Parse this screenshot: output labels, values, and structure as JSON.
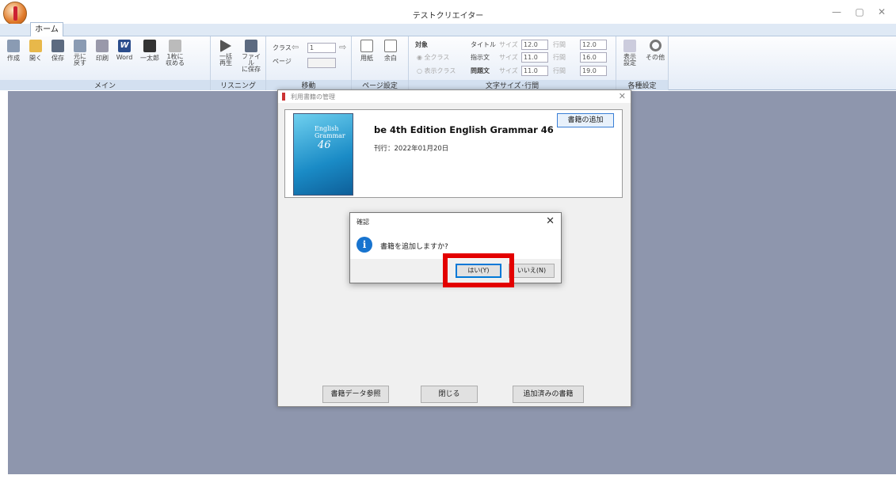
{
  "window": {
    "title": "テストクリエイター",
    "minimize": "—",
    "maximize": "▢",
    "close": "✕"
  },
  "tabs": {
    "home": "ホーム"
  },
  "ribbon": {
    "main": {
      "label": "メイン",
      "create": "作成",
      "open": "開く",
      "save": "保存",
      "undo": "元に\n戻す",
      "print": "印刷",
      "word": "Word",
      "ichitaro": "一太郎",
      "fit": "1枚に\n収める"
    },
    "listening": {
      "label": "リスニング",
      "play_all": "一括\n再生",
      "save_file": "ファイル\nに保存"
    },
    "move": {
      "label": "移動",
      "class": "クラス",
      "page": "ページ",
      "class_value": "1"
    },
    "page_setup": {
      "label": "ページ設定",
      "paper": "用紙",
      "margin": "余白"
    },
    "font": {
      "label": "文字サイズ･行間",
      "target": "対象",
      "all_class": "全クラス",
      "display_class": "表示クラス",
      "title": "タイトル",
      "instruction": "指示文",
      "question": "問題文",
      "size": "サイズ",
      "line": "行間",
      "title_size": "12.0",
      "instruction_size": "11.0",
      "question_size": "11.0",
      "title_line": "12.0",
      "instruction_line": "16.0",
      "question_line": "19.0"
    },
    "settings": {
      "label": "各種設定",
      "display": "表示\n設定",
      "other": "その他"
    }
  },
  "books_dialog": {
    "title": "利用書籍の管理",
    "book_title": "be 4th Edition English Grammar 46",
    "book_date": "刊行：2022年01月20日",
    "cover_line1": "English",
    "cover_line2": "Grammar",
    "cover_num": "46",
    "add_button": "書籍の追加",
    "ref_button": "書籍データ参照",
    "close_button": "閉じる",
    "added_button": "追加済みの書籍"
  },
  "confirm_dialog": {
    "title": "確認",
    "message": "書籍を追加しますか?",
    "yes": "はい(Y)",
    "no": "いいえ(N)",
    "icon": "i",
    "close": "✕"
  },
  "colors": {
    "workspace": "#8e96ad",
    "highlight": "#e30000",
    "info": "#1874cf"
  }
}
